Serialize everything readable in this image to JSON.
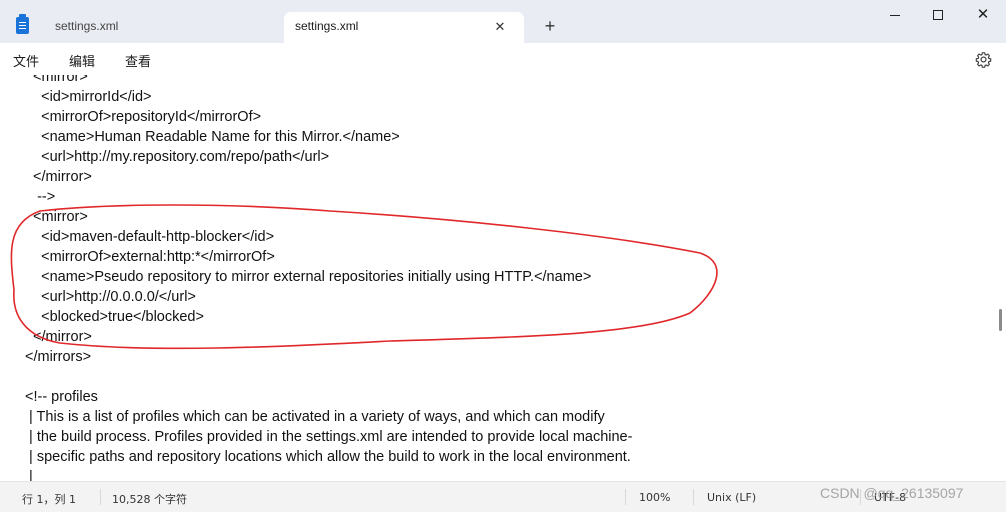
{
  "window": {
    "tabs": [
      {
        "label": "settings.xml",
        "active": false
      },
      {
        "label": "settings.xml",
        "active": true
      }
    ],
    "close_tab_glyph": "✕",
    "new_tab_glyph": "+",
    "close_glyph": "✕"
  },
  "menu": {
    "file": "文件",
    "edit": "编辑",
    "view": "查看"
  },
  "editor": {
    "lines": [
      "  <mirror>",
      "    <id>mirrorId</id>",
      "    <mirrorOf>repositoryId</mirrorOf>",
      "    <name>Human Readable Name for this Mirror.</name>",
      "    <url>http://my.repository.com/repo/path</url>",
      "  </mirror>",
      "   -->",
      "  <mirror>",
      "    <id>maven-default-http-blocker</id>",
      "    <mirrorOf>external:http:*</mirrorOf>",
      "    <name>Pseudo repository to mirror external repositories initially using HTTP.</name>",
      "    <url>http://0.0.0.0/</url>",
      "    <blocked>true</blocked>",
      "  </mirror>",
      "</mirrors>",
      "",
      "<!-- profiles",
      " | This is a list of profiles which can be activated in a variety of ways, and which can modify",
      " | the build process. Profiles provided in the settings.xml are intended to provide local machine-",
      " | specific paths and repository locations which allow the build to work in the local environment.",
      " |"
    ]
  },
  "status": {
    "position": "行 1，列 1",
    "char_count": "10,528 个字符",
    "zoom": "100%",
    "line_ending": "Unix (LF)",
    "encoding": "UTF-8"
  },
  "watermark": "CSDN @qq_26135097",
  "colors": {
    "annotation": "#e0282b",
    "titlebar": "#e9ecf2",
    "app_icon": "#1a73d9"
  }
}
